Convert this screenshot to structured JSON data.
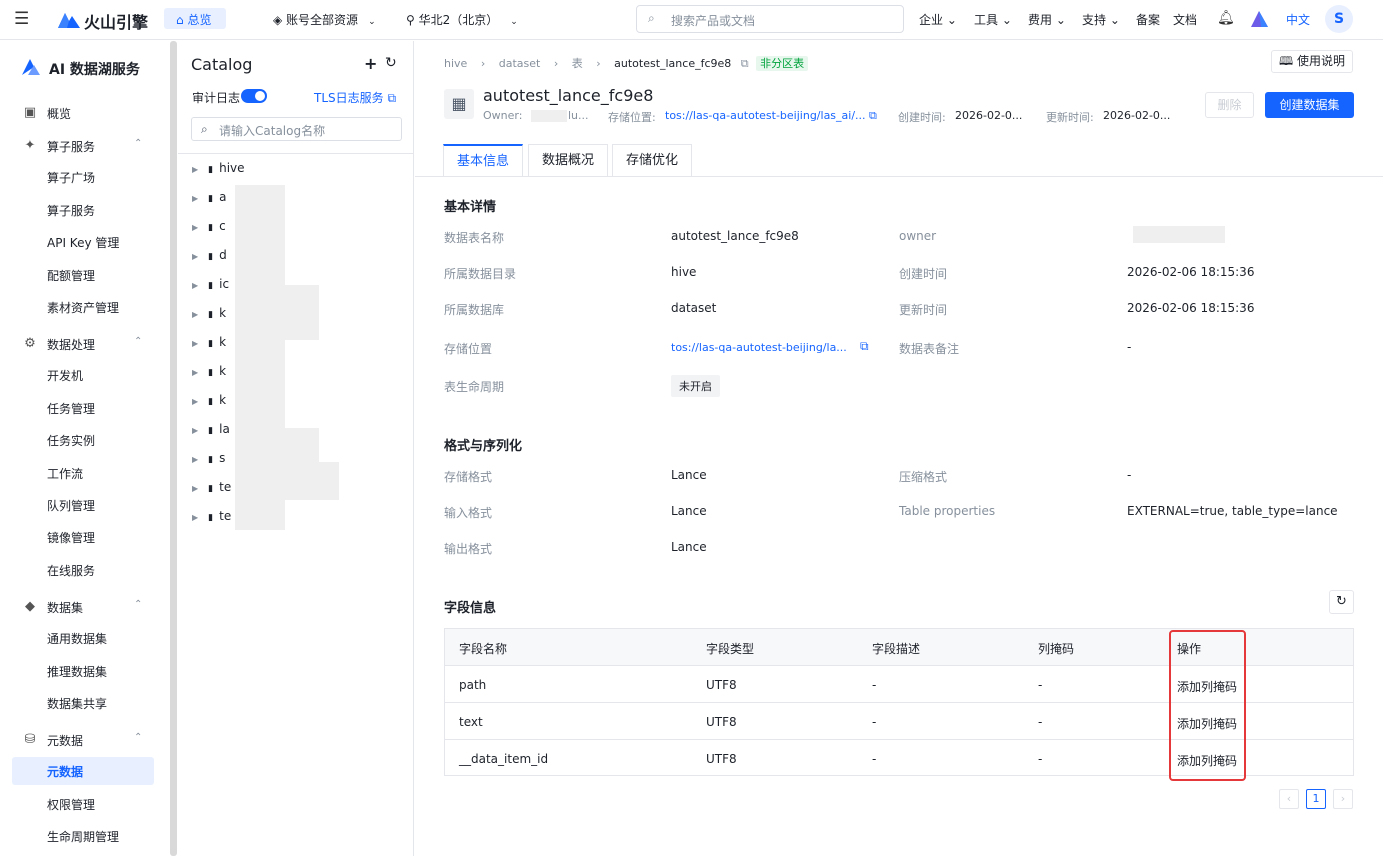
{
  "topbar": {
    "brand": "火山引擎",
    "home": "总览",
    "account": "账号全部资源",
    "region": "华北2（北京）",
    "search_placeholder": "搜索产品或文档",
    "nav": [
      "企业",
      "工具",
      "费用",
      "支持",
      "备案",
      "文档"
    ],
    "lang": "中文",
    "avatar": "S"
  },
  "sidebar": {
    "title": "AI 数据湖服务",
    "overview": "概览",
    "groups": [
      {
        "label": "算子服务",
        "items": [
          "算子广场",
          "算子服务",
          "API Key 管理",
          "配额管理",
          "素材资产管理"
        ]
      },
      {
        "label": "数据处理",
        "items": [
          "开发机",
          "任务管理",
          "任务实例",
          "工作流",
          "队列管理",
          "镜像管理",
          "在线服务"
        ]
      },
      {
        "label": "数据集",
        "items": [
          "通用数据集",
          "推理数据集",
          "数据集共享"
        ]
      },
      {
        "label": "元数据",
        "items": [
          "元数据",
          "权限管理",
          "生命周期管理"
        ]
      }
    ]
  },
  "catalog": {
    "title": "Catalog",
    "audit_label": "审计日志",
    "tls_link": "TLS日志服务",
    "search_placeholder": "请输入Catalog名称",
    "items": [
      "hive",
      "a",
      "c",
      "d",
      "ic",
      "k",
      "k",
      "k",
      "k",
      "la",
      "s",
      "te",
      "te"
    ]
  },
  "breadcrumb": [
    "hive",
    "dataset",
    "表",
    "autotest_lance_fc9e8"
  ],
  "breadcrumb_tag": "非分区表",
  "help": "使用说明",
  "table_header": {
    "name": "autotest_lance_fc9e8",
    "owner_label": "Owner:",
    "owner_value": "lu...",
    "location_label": "存储位置:",
    "location_value": "tos://las-qa-autotest-beijing/las_ai/...",
    "created_label": "创建时间:",
    "created_value": "2026-02-0...",
    "updated_label": "更新时间:",
    "updated_value": "2026-02-0...",
    "delete_btn": "删除",
    "create_btn": "创建数据集"
  },
  "tabs": [
    "基本信息",
    "数据概况",
    "存储优化"
  ],
  "basic": {
    "section_title": "基本详情",
    "table_name_label": "数据表名称",
    "table_name": "autotest_lance_fc9e8",
    "owner_label": "owner",
    "catalog_label": "所属数据目录",
    "catalog": "hive",
    "created_label": "创建时间",
    "created": "2026-02-06 18:15:36",
    "database_label": "所属数据库",
    "database": "dataset",
    "updated_label": "更新时间",
    "updated": "2026-02-06 18:15:36",
    "location_label": "存储位置",
    "location": "tos://las-qa-autotest-beijing/la...",
    "remark_label": "数据表备注",
    "remark": "-",
    "lifecycle_label": "表生命周期",
    "lifecycle": "未开启"
  },
  "format": {
    "section_title": "格式与序列化",
    "storage_label": "存储格式",
    "storage": "Lance",
    "compress_label": "压缩格式",
    "compress": "-",
    "input_label": "输入格式",
    "input": "Lance",
    "props_label": "Table properties",
    "props": "EXTERNAL=true, table_type=lance",
    "output_label": "输出格式",
    "output": "Lance"
  },
  "fields": {
    "section_title": "字段信息",
    "headers": [
      "字段名称",
      "字段类型",
      "字段描述",
      "列掩码",
      "操作"
    ],
    "rows": [
      {
        "name": "path",
        "type": "UTF8",
        "desc": "-",
        "mask": "-",
        "action": "添加列掩码"
      },
      {
        "name": "text",
        "type": "UTF8",
        "desc": "-",
        "mask": "-",
        "action": "添加列掩码"
      },
      {
        "name": "__data_item_id",
        "type": "UTF8",
        "desc": "-",
        "mask": "-",
        "action": "添加列掩码"
      }
    ],
    "page": "1"
  },
  "colors": {
    "accent": "#1664ff",
    "highlight": "#e5383b"
  }
}
